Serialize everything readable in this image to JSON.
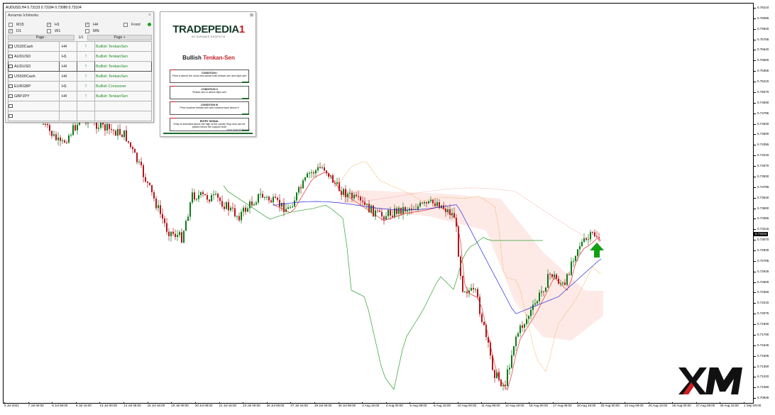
{
  "chart": {
    "symbol_header": "AUDUSD,H4  0.73133 0.73184 0.73080 0.73104",
    "current_price": "0.73104",
    "colors": {
      "bull": "#0b7a16",
      "bear": "#b0161c",
      "tenkan": "#e32b2b",
      "kijun": "#2b2bde",
      "chikou": "#2da02f",
      "span_a": "#f0a030",
      "span_b": "#f08080"
    },
    "price_ticks": [
      "0.76210",
      "0.76065",
      "0.75920",
      "0.75785",
      "0.75640",
      "0.75500",
      "0.75355",
      "0.75215",
      "0.75070",
      "0.74930",
      "0.74785",
      "0.74640",
      "0.74500",
      "0.74355",
      "0.74215",
      "0.74070",
      "0.73930",
      "0.73785",
      "0.73640",
      "0.73500",
      "0.73355",
      "0.73215",
      "0.73070",
      "0.72930",
      "0.72785",
      "0.72645",
      "0.72500",
      "0.72360",
      "0.72215",
      "0.72075",
      "0.71930",
      "0.71790",
      "0.71645",
      "0.71505",
      "0.71360",
      "0.71220",
      "0.71080",
      "0.70935"
    ],
    "time_ticks": [
      "5 Jul 2021",
      "7 Jul 00:00",
      "8 Jul 08:00",
      "9 Jul 16:00",
      "13 Jul 00:00",
      "14 Jul 08:00",
      "15 Jul 16:00",
      "19 Jul 00:00",
      "20 Jul 08:00",
      "21 Jul 16:00",
      "23 Jul 00:00",
      "26 Jul 08:00",
      "27 Jul 16:00",
      "29 Jul 00:00",
      "30 Jul 08:00",
      "2 Aug 16:00",
      "4 Aug 00:00",
      "5 Aug 08:00",
      "6 Aug 16:00",
      "10 Aug 00:00",
      "11 Aug 08:00",
      "12 Aug 16:00",
      "16 Aug 00:00",
      "17 Aug 08:00",
      "18 Aug 16:00",
      "20 Aug 00:00",
      "23 Aug 08:00",
      "24 Aug 16:00",
      "26 Aug 00:00",
      "27 Aug 08:00",
      "30 Aug 16:00",
      "1 Sep 00:00"
    ]
  },
  "ichimoku_panel": {
    "title": "Avramis Ichimoku",
    "close_icon": "close-icon",
    "timeframes": [
      {
        "label": "M15",
        "checked": false
      },
      {
        "label": "H1",
        "checked": true
      },
      {
        "label": "H4",
        "checked": true
      },
      {
        "label": "Front",
        "checked": false
      },
      {
        "label": "D1",
        "checked": true
      },
      {
        "label": "W1",
        "checked": false
      },
      {
        "label": "MN",
        "checked": false
      }
    ],
    "page_prev": "Page -",
    "page_indicator": "1/1",
    "page_next": "Page +",
    "rows": [
      {
        "symbol": "US30Cash",
        "tf": "H4",
        "arrow": "↑",
        "signal": "Bullish TenkanSen"
      },
      {
        "symbol": "AUDUSD",
        "tf": "H1",
        "arrow": "↑",
        "signal": "Bullish TenkanSen"
      },
      {
        "symbol": "AUDUSD",
        "tf": "H4",
        "arrow": "↑",
        "signal": "Bullish TenkanSen"
      },
      {
        "symbol": "US500Cash",
        "tf": "H4",
        "arrow": "↑",
        "signal": "Bullish TenkanSen"
      },
      {
        "symbol": "EURGBP",
        "tf": "H1",
        "arrow": "↑",
        "signal": "Bullish Crossover"
      },
      {
        "symbol": "GBPJPY",
        "tf": "H4",
        "arrow": "↑",
        "signal": "Bullish TenkanSen"
      },
      {
        "symbol": "",
        "tf": "",
        "arrow": "",
        "signal": ""
      },
      {
        "symbol": "",
        "tf": "",
        "arrow": "",
        "signal": ""
      }
    ]
  },
  "tradepedia_panel": {
    "close_icon": "close-icon",
    "logo_main": "TRADEPEDIA",
    "logo_mark": "1",
    "byline": "BY AVRAMIS DESPOTIS",
    "heading_prefix": "Bullish",
    "heading_highlight": "Tenkan-Sen",
    "conditions": [
      {
        "title": "CONDITION I",
        "text": "Price is above the cloud and above both tenkan-sen and kijun-sen"
      },
      {
        "title": "CONDITION II",
        "text": "Tenkan-sen is above kijun-sen"
      },
      {
        "title": "CONDITION III",
        "text": "Price touches tenkan-sen and crosses back above it"
      },
      {
        "title": "ENTRY SIGNAL",
        "text": "Entry is activated above the high of the candle Stop loss can be placed below the support level"
      }
    ],
    "site": "www.tradepedia.com"
  },
  "xm_logo": {
    "text": "XM",
    "icon": "xm-logo-icon"
  }
}
